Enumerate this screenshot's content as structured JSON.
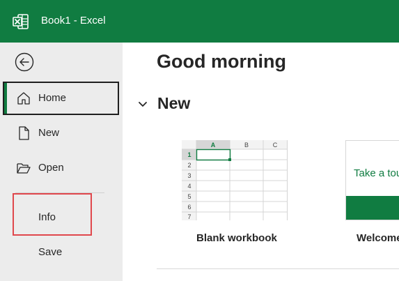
{
  "window": {
    "title": "Book1  -  Excel",
    "app_icon": "excel-logo-icon",
    "accent_color": "#107c41"
  },
  "sidebar": {
    "back_icon": "back-arrow-icon",
    "items": [
      {
        "label": "Home",
        "icon": "home-icon",
        "selected": true
      },
      {
        "label": "New",
        "icon": "new-document-icon"
      },
      {
        "label": "Open",
        "icon": "folder-open-icon"
      },
      {
        "label": "Info",
        "highlighted": true
      },
      {
        "label": "Save"
      }
    ]
  },
  "main": {
    "greeting": "Good morning",
    "section": {
      "title": "New",
      "toggle_icon": "chevron-down-icon"
    },
    "templates": [
      {
        "label": "Blank workbook",
        "columns": [
          "A",
          "B",
          "C"
        ],
        "rows": [
          "1",
          "2",
          "3",
          "4",
          "5",
          "6",
          "7"
        ]
      },
      {
        "label": "Welcome",
        "preview_text": "Take a tou"
      }
    ]
  }
}
